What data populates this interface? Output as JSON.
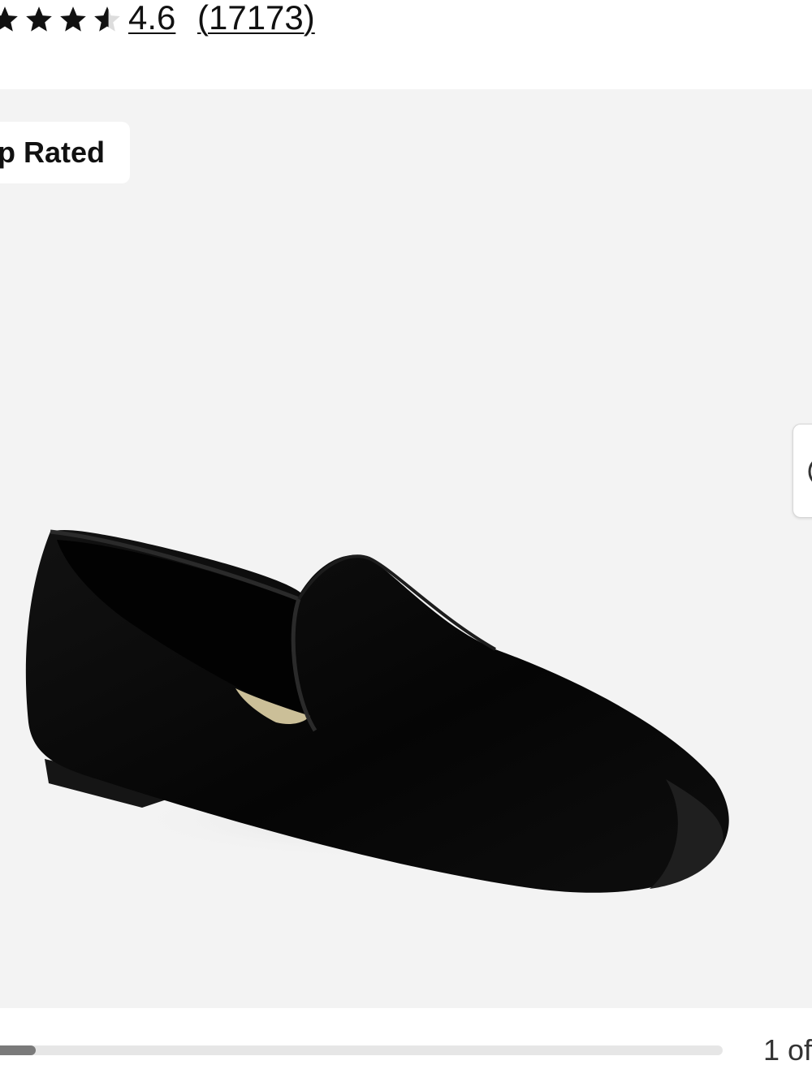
{
  "rating": {
    "value": "4.6",
    "count": "(17173)",
    "stars_filled": 4.6,
    "stars_total": 5
  },
  "gallery": {
    "badge": "p Rated",
    "image_icon": "loafer-shoe-image",
    "next_icon": "chevron-right-icon"
  },
  "pager": {
    "text": "1 of",
    "progress_fraction": 0.06
  },
  "colors": {
    "gallery_bg": "#f3f3f3",
    "star": "#111111",
    "progress_fill": "#7a7a7a",
    "progress_track": "#e6e6e6"
  }
}
